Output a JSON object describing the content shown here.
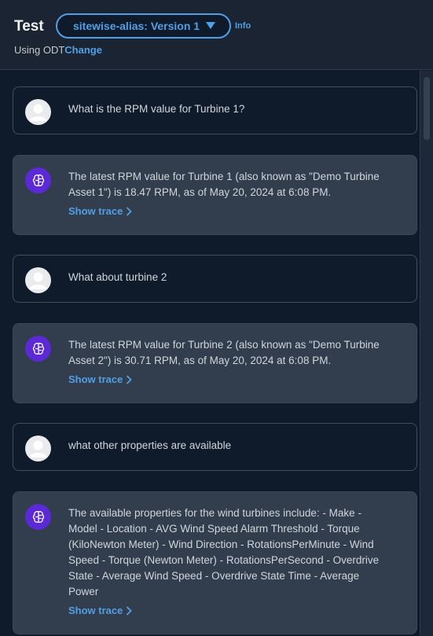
{
  "header": {
    "title": "Test",
    "alias_select": "sitewise-alias: Version 1",
    "info": "Info",
    "using_text": "Using ODT",
    "change": "Change"
  },
  "messages": [
    {
      "role": "user",
      "text": "What is the RPM value for Turbine 1?"
    },
    {
      "role": "assistant",
      "text": "The latest RPM value for Turbine 1 (also known as \"Demo Turbine Asset 1\") is 18.47 RPM, as of May 20, 2024 at 6:08 PM.",
      "trace": "Show trace"
    },
    {
      "role": "user",
      "text": "What about turbine 2"
    },
    {
      "role": "assistant",
      "text": "The latest RPM value for Turbine 2 (also known as \"Demo Turbine Asset 2\") is 30.71 RPM, as of May 20, 2024 at 6:08 PM.",
      "trace": "Show trace"
    },
    {
      "role": "user",
      "text": "what other properties are available"
    },
    {
      "role": "assistant",
      "text": "The available properties for the wind turbines include: - Make - Model - Location - AVG Wind Speed Alarm Threshold - Torque (KiloNewton Meter) - Wind Direction - RotationsPerMinute - Wind Speed - Torque (Newton Meter) - RotationsPerSecond - Overdrive State - Average Wind Speed - Overdrive State Time - Average Power",
      "trace": "Show trace"
    }
  ],
  "icons": {
    "user_avatar": "user-icon",
    "bot_avatar": "brain-icon",
    "trace_chevron": "chevron-right-icon",
    "select_caret": "caret-down-icon"
  },
  "colors": {
    "background": "#0f1b2a",
    "header": "#1a2433",
    "bot_bubble": "#323e4d",
    "link": "#539fe5",
    "bot_avatar": "#5b2ad6"
  }
}
